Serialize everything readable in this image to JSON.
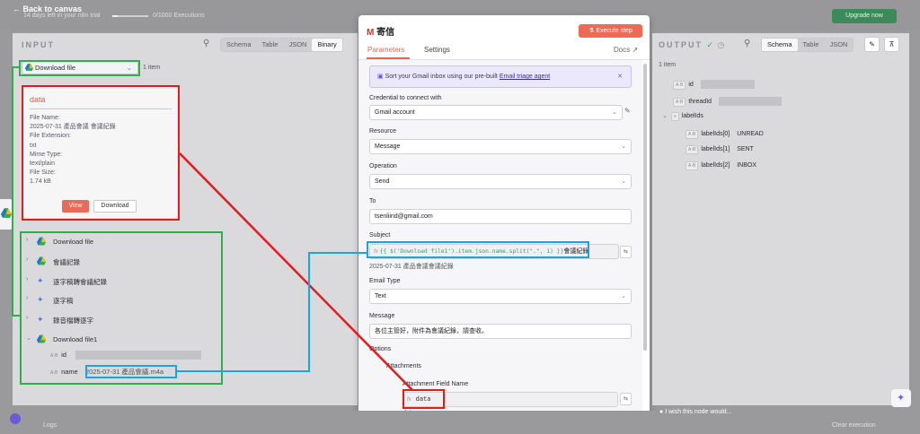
{
  "topbar": {
    "back_label": "Back to canvas",
    "trial_text": "14 days left in your n8n trial",
    "trial_progress": 0.15,
    "executions_text": "0/1000 Executions",
    "upgrade_label": "Upgrade now"
  },
  "input": {
    "heading": "INPUT",
    "tabs": [
      "Schema",
      "Table",
      "JSON",
      "Binary"
    ],
    "active_tab": "Binary",
    "node_select": "Download file",
    "count": "1 item",
    "card": {
      "title": "data",
      "file_name_label": "File Name:",
      "file_name": "2025-07-31 產品會議 會議紀錄",
      "file_ext_label": "File Extension:",
      "file_ext": "txt",
      "mime_label": "Mime Type:",
      "mime": "text/plain",
      "size_label": "File Size:",
      "size": "1.74 kB",
      "view_label": "View",
      "download_label": "Download"
    },
    "tree": [
      {
        "label": "Download file",
        "icon": "google-drive-icon"
      },
      {
        "label": "會議記錄",
        "icon": "google-drive-icon"
      },
      {
        "label": "逐字稿轉會議紀錄",
        "icon": "ai-sparkle-icon"
      },
      {
        "label": "逐字稿",
        "icon": "ai-sparkle-icon"
      },
      {
        "label": "錄音檔轉逐字",
        "icon": "ai-sparkle-icon"
      },
      {
        "label": "Download file1",
        "icon": "google-drive-icon"
      }
    ],
    "fields": {
      "id_label": "id",
      "name_label": "name",
      "name_value": "2025-07-31 產品會議.m4a"
    }
  },
  "node": {
    "title": "寄信",
    "execute_label": "Execute step",
    "tab_parameters": "Parameters",
    "tab_settings": "Settings",
    "docs_label": "Docs",
    "banner_text": "Sort your Gmail inbox using our pre-built",
    "banner_link": "Email triage agent",
    "credential_label": "Credential to connect with",
    "credential_value": "Gmail account",
    "resource_label": "Resource",
    "resource_value": "Message",
    "operation_label": "Operation",
    "operation_value": "Send",
    "to_label": "To",
    "to_value": "tsenliind@gmail.com",
    "subject_label": "Subject",
    "subject_expr": "{{ $('Download file1').item.json.name.split(\".\", 1) }}",
    "subject_suffix": "會議紀錄",
    "subject_preview": "2025-07-31 產品會議會議紀錄",
    "email_type_label": "Email Type",
    "email_type_value": "Text",
    "message_label": "Message",
    "message_value": "各位主管好，附件為會議紀錄，請查收。",
    "options_label": "Options",
    "attachments_label": "Attachments",
    "attach_field_label": "Attachment Field Name",
    "attach_field_value": "data",
    "attach_preview": "data",
    "fx": "fx"
  },
  "output": {
    "heading": "OUTPUT",
    "tabs": [
      "Schema",
      "Table",
      "JSON"
    ],
    "active_tab": "Schema",
    "count": "1 item",
    "fields": {
      "id": "id",
      "threadId": "threadId",
      "labelIds": "labelIds",
      "label0_key": "labelIds[0]",
      "label0_val": "UNREAD",
      "label1_key": "labelIds[1]",
      "label1_val": "SENT",
      "label2_key": "labelIds[2]",
      "label2_val": "INBOX"
    }
  },
  "footer": {
    "logs": "Logs",
    "feedback": "I wish this node would...",
    "clear": "Clear execution"
  },
  "colors": {
    "accent": "#ee6a55",
    "highlight_green": "#2fae4c",
    "highlight_red": "#e21b1b",
    "highlight_blue": "#1aa5e0"
  }
}
